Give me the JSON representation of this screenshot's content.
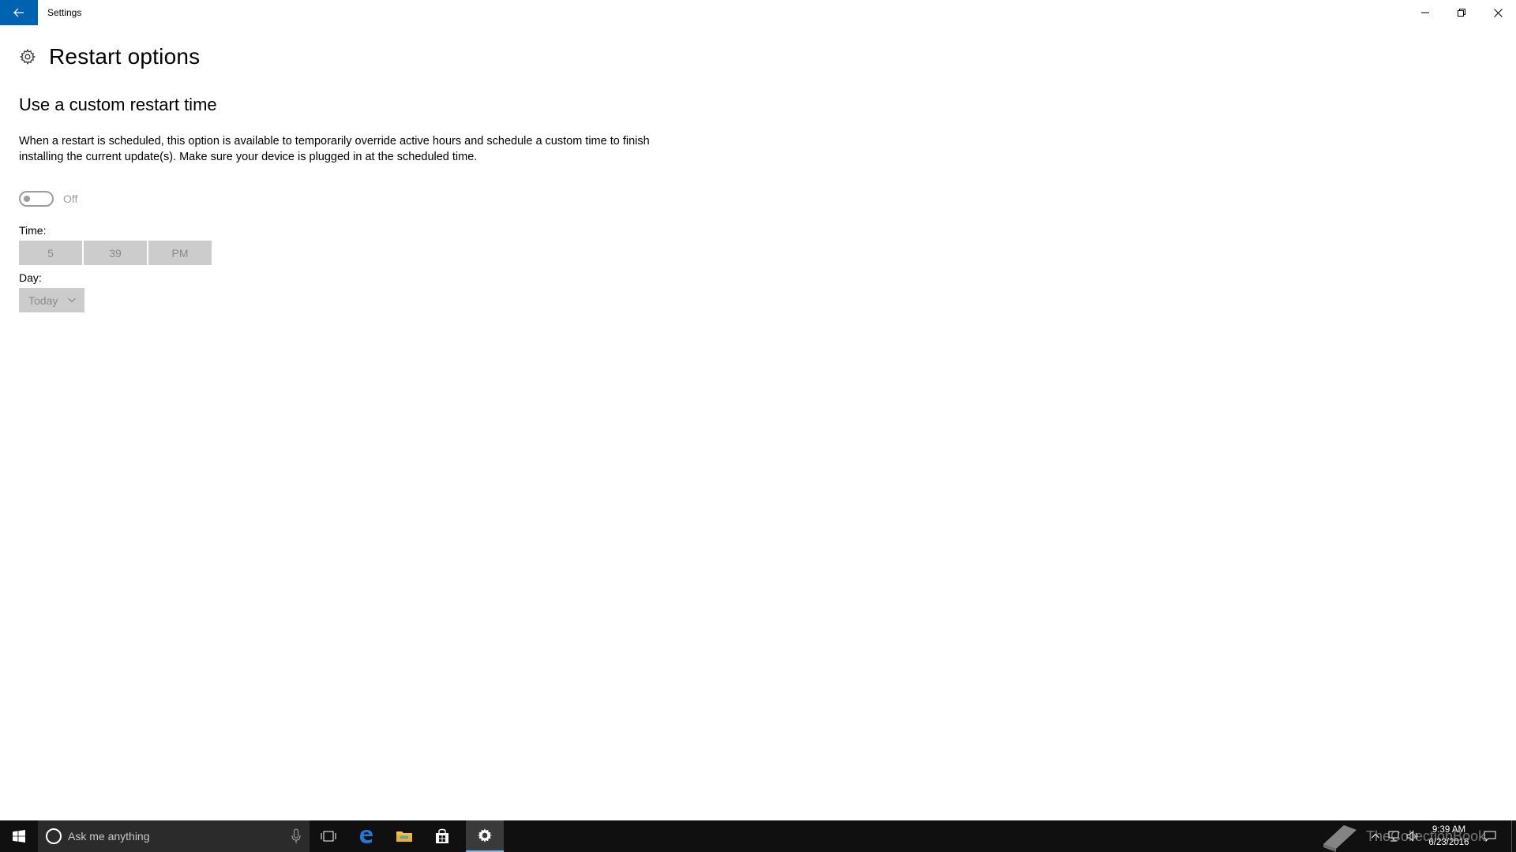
{
  "window": {
    "title": "Settings"
  },
  "page": {
    "title": "Restart options",
    "section_title": "Use a custom restart time",
    "description": "When a restart is scheduled, this option is available to temporarily override active hours and schedule a custom time to finish installing the current update(s). Make sure your device is plugged in at the scheduled time.",
    "toggle_state": "Off",
    "time_label": "Time:",
    "time": {
      "hour": "5",
      "minute": "39",
      "period": "PM"
    },
    "day_label": "Day:",
    "day_value": "Today"
  },
  "taskbar": {
    "search_placeholder": "Ask me anything",
    "clock_time": "9:39 AM",
    "clock_date": "6/23/2016",
    "accent": "#76b9ed"
  },
  "watermark": "TheCollectionBook",
  "colors": {
    "accent": "#0063b1",
    "disabled_text": "#8a8a8a",
    "disabled_bg": "#cccccc"
  }
}
